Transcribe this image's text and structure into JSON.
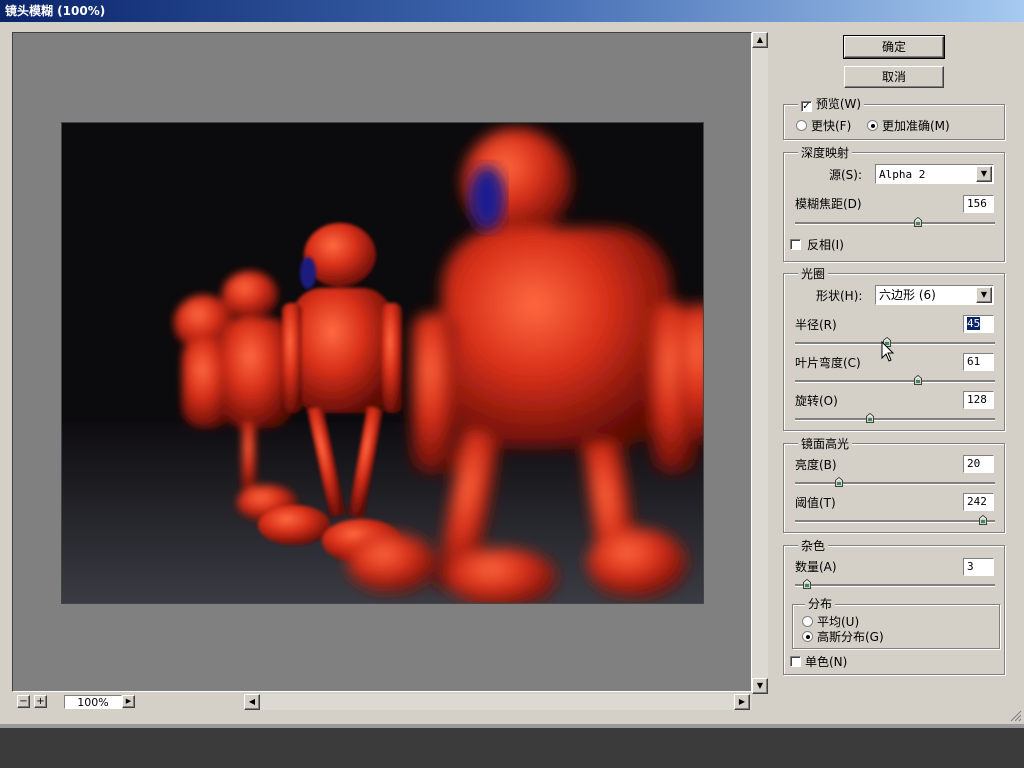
{
  "window": {
    "title": "镜头模糊 (100%)"
  },
  "buttons": {
    "ok": "确定",
    "cancel": "取消"
  },
  "preview": {
    "label": "预览(W)",
    "checked": true,
    "faster": "更快(F)",
    "more_accurate": "更加准确(M)",
    "selected_mode": "more_accurate"
  },
  "depth_map": {
    "title": "深度映射",
    "source_label": "源(S):",
    "source_value": "Alpha 2",
    "blur_focal_label": "模糊焦距(D)",
    "blur_focal_value": "156",
    "blur_focal_fraction": 0.61,
    "invert_label": "反相(I)",
    "invert_checked": false
  },
  "iris": {
    "title": "光圈",
    "shape_label": "形状(H):",
    "shape_value": "六边形 (6)",
    "radius_label": "半径(R)",
    "radius_value": "45",
    "radius_fraction": 0.45,
    "curvature_label": "叶片弯度(C)",
    "curvature_value": "61",
    "curvature_fraction": 0.61,
    "rotation_label": "旋转(O)",
    "rotation_value": "128",
    "rotation_fraction": 0.36
  },
  "specular": {
    "title": "镜面高光",
    "brightness_label": "亮度(B)",
    "brightness_value": "20",
    "brightness_fraction": 0.2,
    "threshold_label": "阈值(T)",
    "threshold_value": "242",
    "threshold_fraction": 0.95
  },
  "noise": {
    "title": "杂色",
    "amount_label": "数量(A)",
    "amount_value": "3",
    "amount_fraction": 0.03,
    "distribution_title": "分布",
    "uniform_label": "平均(U)",
    "gaussian_label": "高斯分布(G)",
    "selected_distribution": "gaussian",
    "mono_label": "单色(N)",
    "mono_checked": false
  },
  "zoom": {
    "value": "100%"
  },
  "icons": {
    "zoom_out": "minus-icon",
    "zoom_in": "plus-icon",
    "cursor": "arrow-cursor-icon"
  }
}
